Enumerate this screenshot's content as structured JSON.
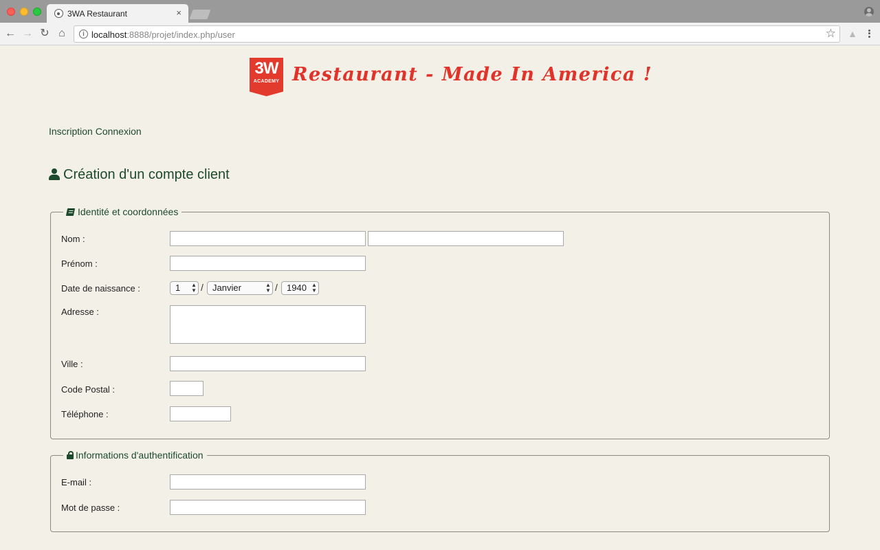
{
  "browser": {
    "tab_title": "3WA Restaurant",
    "tab_close": "×",
    "url_host": "localhost",
    "url_rest": ":8888/projet/index.php/user"
  },
  "header": {
    "logo_text": "3W",
    "logo_subtext": "ACADEMY",
    "title": "Restaurant - Made In America !"
  },
  "nav": {
    "inscription": "Inscription",
    "connexion": "Connexion"
  },
  "page_title": "Création d'un compte client",
  "identity": {
    "legend": "Identité et coordonnées",
    "nom_label": "Nom :",
    "prenom_label": "Prénom :",
    "birth_label": "Date de naissance :",
    "birth_day": "1",
    "birth_month": "Janvier",
    "birth_year": "1940",
    "date_sep": "/",
    "adresse_label": "Adresse :",
    "ville_label": "Ville :",
    "cp_label": "Code Postal :",
    "tel_label": "Téléphone :"
  },
  "auth": {
    "legend": "Informations d'authentification",
    "email_label": "E-mail :",
    "password_label": "Mot de passe :"
  }
}
